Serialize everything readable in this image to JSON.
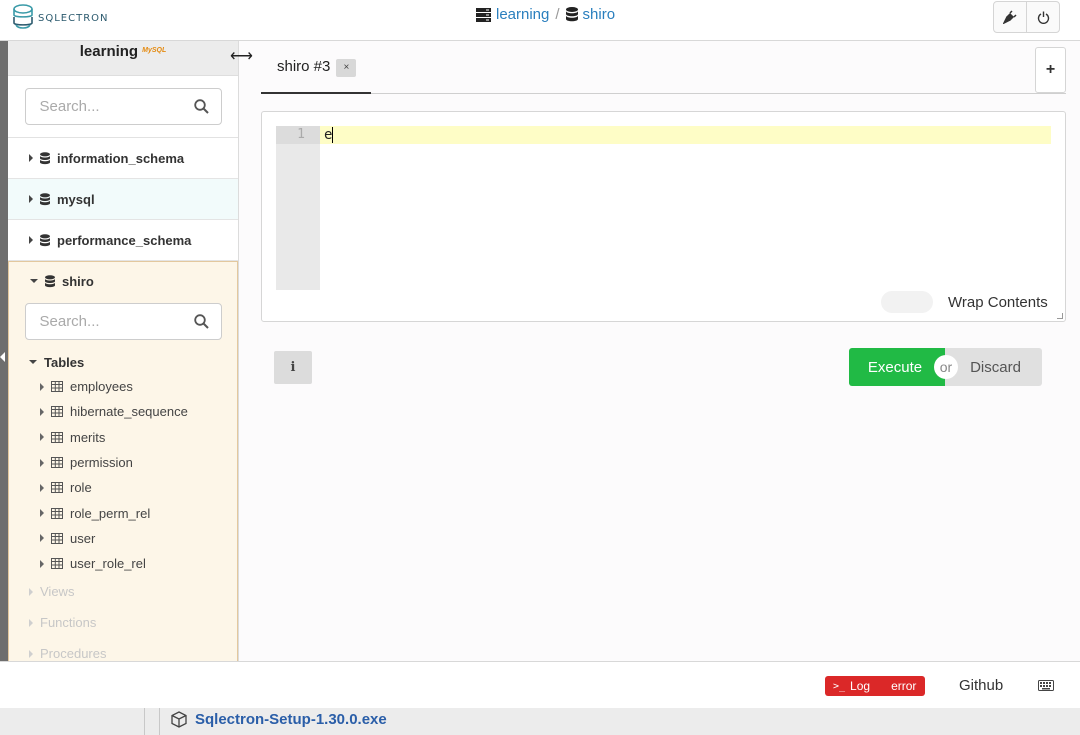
{
  "header": {
    "logo_text": "SQLECTRON",
    "breadcrumb": [
      {
        "label": "learning",
        "icon": "server-icon"
      },
      {
        "label": "shiro",
        "icon": "database-icon"
      }
    ],
    "separator": "/",
    "buttons": [
      {
        "name": "disconnect-button",
        "icon": "plug-icon"
      },
      {
        "name": "power-button",
        "icon": "power-icon"
      }
    ]
  },
  "sidebar": {
    "connection_title": "learning",
    "db_logo_text": "MySQL",
    "search_placeholder": "Search...",
    "databases": [
      {
        "name": "information_schema"
      },
      {
        "name": "mysql"
      },
      {
        "name": "performance_schema"
      }
    ],
    "open_database": {
      "name": "shiro",
      "search_placeholder": "Search...",
      "tables_label": "Tables",
      "tables": [
        "employees",
        "hibernate_sequence",
        "merits",
        "permission",
        "role",
        "role_perm_rel",
        "user",
        "user_role_rel"
      ],
      "views_label": "Views",
      "functions_label": "Functions",
      "procedures_label": "Procedures"
    }
  },
  "tabs": [
    {
      "label": "shiro #3",
      "close": "×",
      "active": true
    }
  ],
  "tab_add_label": "+",
  "editor": {
    "line_number": "1",
    "content": "e",
    "wrap_label": "Wrap Contents",
    "wrap_enabled": false
  },
  "actions": {
    "info_label": "i",
    "execute_label": "Execute",
    "or_label": "or",
    "discard_label": "Discard"
  },
  "footer": {
    "log_label": "Log",
    "log_prompt": ">_",
    "log_status": "error",
    "github_label": "Github"
  },
  "taskbar": {
    "download_label": "Sqlectron-Setup-1.30.0.exe"
  },
  "colors": {
    "accent_blue": "#2a7fbe",
    "execute_green": "#21ba45",
    "error_red": "#db2828",
    "active_line": "#fefdc6",
    "open_db_bg": "#fdf6e8"
  }
}
